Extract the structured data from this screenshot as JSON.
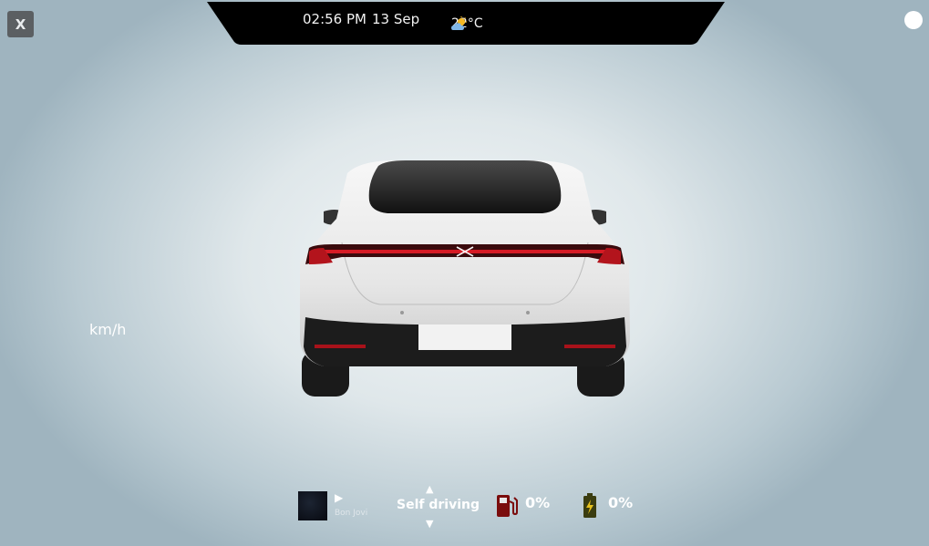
{
  "close_button": {
    "label": "X"
  },
  "top_bar": {
    "time": "02:56 PM",
    "date": "13 Sep",
    "weather": {
      "icon": "partly-sunny-icon",
      "temperature": "22°C"
    }
  },
  "speed": {
    "unit": "km/h"
  },
  "media": {
    "play_symbol": "▶",
    "artist": "Bon Jovi"
  },
  "drive_mode": {
    "up_symbol": "▲",
    "label": "Self driving",
    "down_symbol": "▼"
  },
  "fuel": {
    "icon": "fuel-pump-icon",
    "value": "0%"
  },
  "battery": {
    "icon": "battery-icon",
    "value": "0%"
  },
  "colors": {
    "top_bar": "#000000",
    "fuel_icon": "#7a0c0c",
    "battery_icon": "#3b3d10",
    "car_light": "#d61a24"
  }
}
